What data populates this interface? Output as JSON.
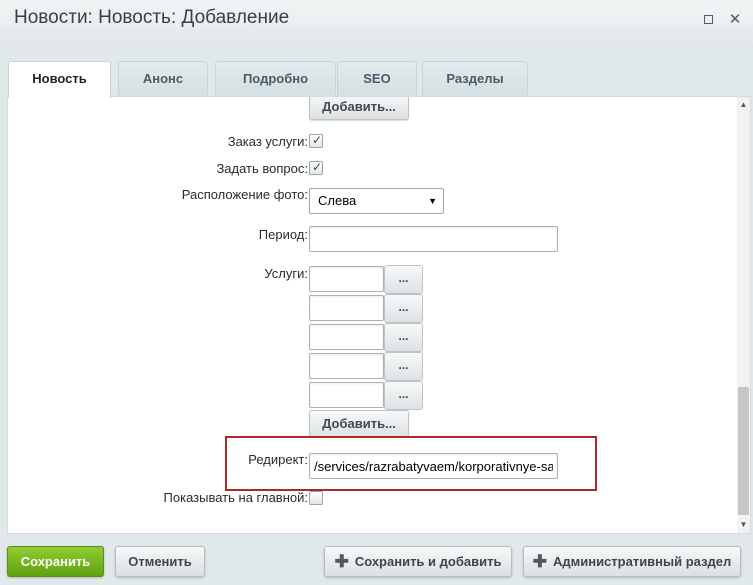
{
  "window": {
    "title": "Новости: Новость: Добавление",
    "maximize_icon": "maximize-icon",
    "close_icon": "close-icon",
    "close_glyph": "✕"
  },
  "tabs": [
    {
      "label": "Новость",
      "active": true
    },
    {
      "label": "Анонс"
    },
    {
      "label": "Подробно"
    },
    {
      "label": "SEO"
    },
    {
      "label": "Разделы"
    }
  ],
  "form": {
    "add_top_label": "Добавить...",
    "order_service": {
      "label": "Заказ услуги:",
      "checked": true
    },
    "ask_question": {
      "label": "Задать вопрос:",
      "checked": true
    },
    "photo_position": {
      "label": "Расположение фото:",
      "value": "Слева"
    },
    "period": {
      "label": "Период:",
      "value": ""
    },
    "services": {
      "label": "Услуги:",
      "rows": [
        "",
        "",
        "",
        "",
        ""
      ],
      "browse_label": "...",
      "add_label": "Добавить..."
    },
    "redirect": {
      "label": "Редирект:",
      "value": "/services/razrabatyvaem/korporativnye-sayty/"
    },
    "show_on_main": {
      "label": "Показывать на главной:",
      "checked": false
    },
    "check_glyph": "✓"
  },
  "footer": {
    "save_label": "Сохранить",
    "cancel_label": "Отменить",
    "save_add_label": "Сохранить и добавить",
    "admin_section_label": "Административный раздел",
    "plus_glyph": "✚"
  },
  "colors": {
    "save_green": "#6db31a",
    "highlight_red": "#b0262c"
  }
}
